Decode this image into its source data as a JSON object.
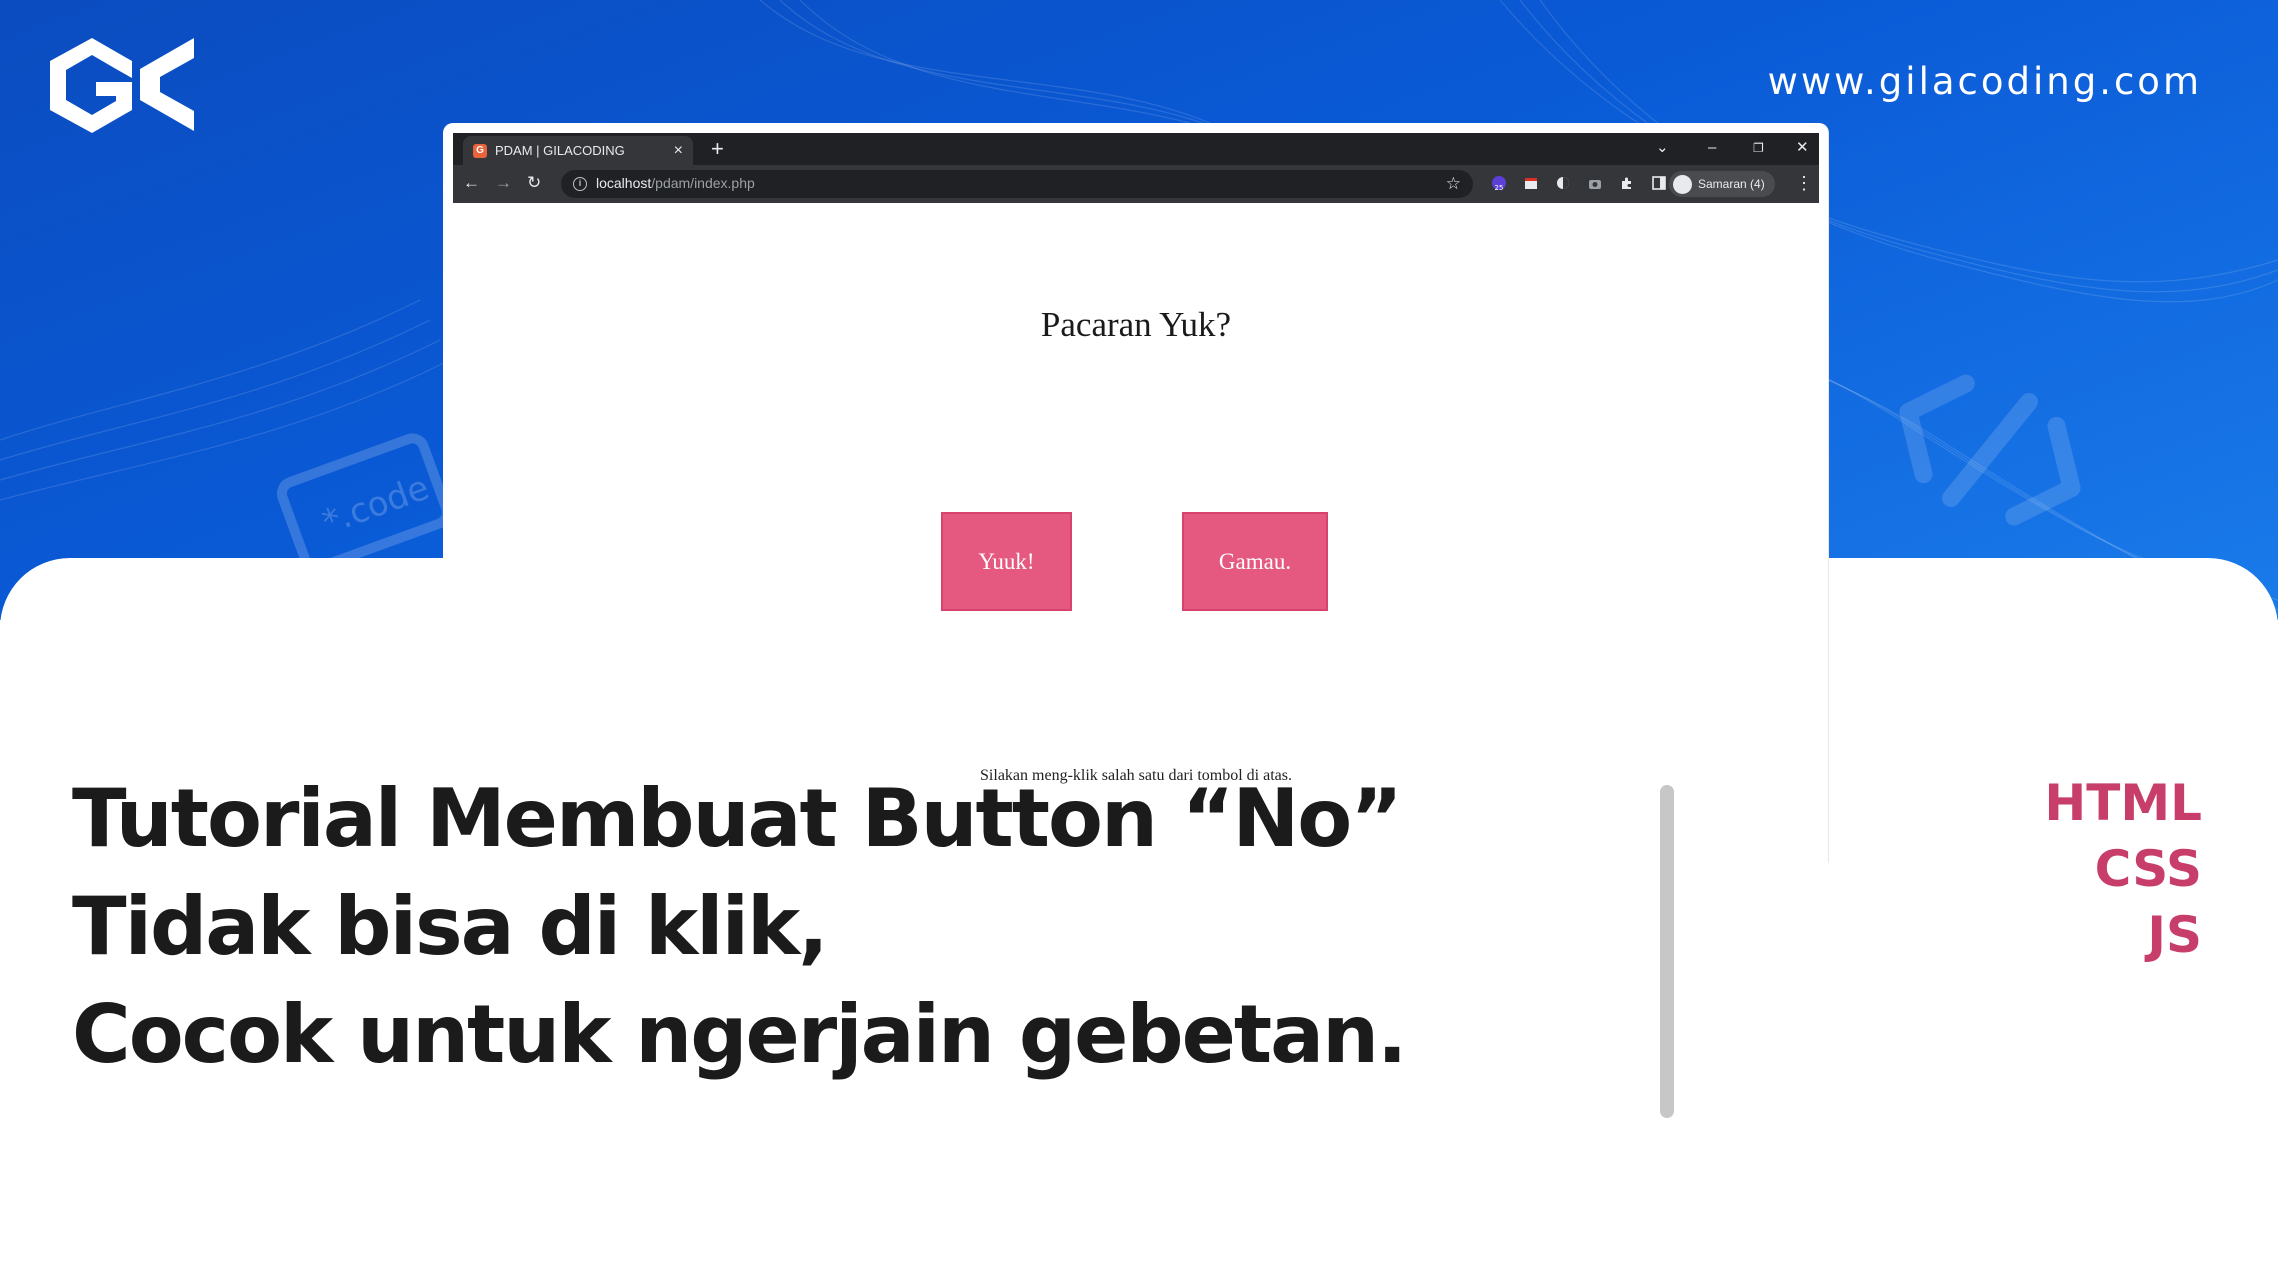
{
  "brand": {
    "logo_text": "GK",
    "website": "www.gilacoding.com"
  },
  "browser": {
    "tab_title": "PDAM | GILACODING",
    "tab_favicon_text": "G",
    "url_host": "localhost",
    "url_path": "/pdam/index.php",
    "profile_label": "Samaran (4)",
    "extension_badge": "25"
  },
  "page": {
    "heading": "Pacaran Yuk?",
    "yes_button": "Yuuk!",
    "no_button": "Gamau.",
    "hint": "Silakan meng-klik salah satu dari tombol di atas."
  },
  "headline": {
    "line1": "Tutorial Membuat Button “No”",
    "line2": "Tidak bisa di klik,",
    "line3": "Cocok untuk ngerjain gebetan."
  },
  "tags": [
    "HTML",
    "CSS",
    "JS"
  ],
  "decorations": {
    "left_badge_text": "*.code",
    "right_glyph": "</>"
  },
  "colors": {
    "hero_blue": "#0a5ad6",
    "button_pink": "#e5587f",
    "tag_pink": "#c73e6b",
    "headline": "#1b1b1b"
  }
}
